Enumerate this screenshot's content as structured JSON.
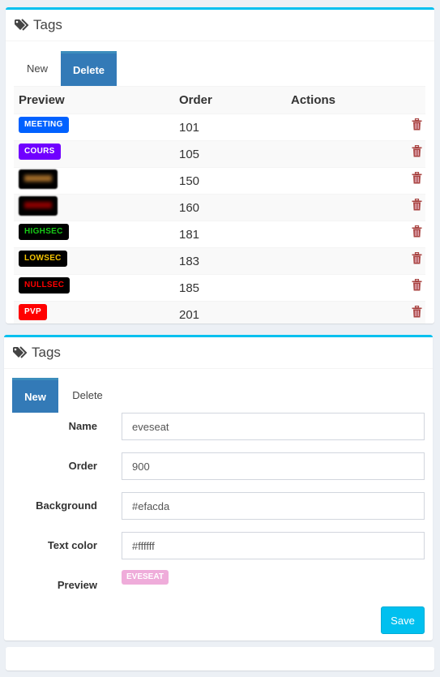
{
  "list_panel": {
    "title": "Tags",
    "tabs": [
      {
        "label": "New",
        "active": false
      },
      {
        "label": "Delete",
        "active": true
      }
    ],
    "columns": [
      "Preview",
      "Order",
      "Actions"
    ],
    "rows": [
      {
        "name": "MEETING",
        "order": "101",
        "bg": "#0061ff",
        "fg": "#ffffff",
        "blurred": false
      },
      {
        "name": "COURS",
        "order": "105",
        "bg": "#7000ff",
        "fg": "#ffffff",
        "blurred": false
      },
      {
        "name": "",
        "order": "150",
        "bg": "#000000",
        "fg": "#a06a28",
        "blurred": true
      },
      {
        "name": "",
        "order": "160",
        "bg": "#000000",
        "fg": "#8b0000",
        "blurred": true
      },
      {
        "name": "HIGHSEC",
        "order": "181",
        "bg": "#000000",
        "fg": "#16c916",
        "blurred": false
      },
      {
        "name": "LOWSEC",
        "order": "183",
        "bg": "#000000",
        "fg": "#f5c400",
        "blurred": false
      },
      {
        "name": "NULLSEC",
        "order": "185",
        "bg": "#000000",
        "fg": "#ff0000",
        "blurred": false
      },
      {
        "name": "PVP",
        "order": "201",
        "bg": "#ff0000",
        "fg": "#ffffff",
        "blurred": false
      },
      {
        "name": "",
        "order": "",
        "bg": "#1cde1c",
        "fg": "#ffffff",
        "blurred": false
      }
    ],
    "action_icon": "trash-icon"
  },
  "form_panel": {
    "title": "Tags",
    "tabs": [
      {
        "label": "New",
        "active": true
      },
      {
        "label": "Delete",
        "active": false
      }
    ],
    "fields": {
      "name": {
        "label": "Name",
        "value": "eveseat"
      },
      "order": {
        "label": "Order",
        "value": "900"
      },
      "background": {
        "label": "Background",
        "value": "#efacda"
      },
      "text_color": {
        "label": "Text color",
        "value": "#ffffff"
      }
    },
    "preview_label": "Preview",
    "preview_text": "EVESEAT",
    "preview_bg": "#efacda",
    "save_label": "Save"
  },
  "colors": {
    "accent": "#00c0ef",
    "tab_active": "#337ab7",
    "danger": "#a94442"
  }
}
